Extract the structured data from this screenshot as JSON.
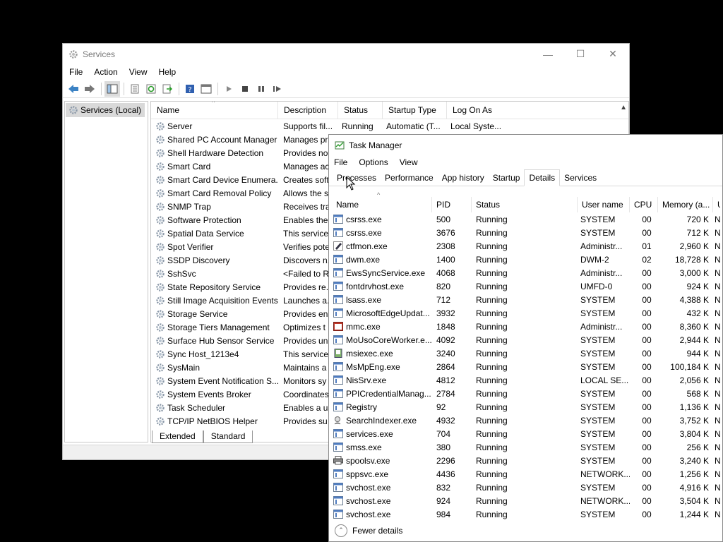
{
  "services": {
    "title": "Services",
    "menu": [
      "File",
      "Action",
      "View",
      "Help"
    ],
    "tree_item": "Services (Local)",
    "columns": [
      "Name",
      "Description",
      "Status",
      "Startup Type",
      "Log On As"
    ],
    "rows": [
      {
        "name": "Server",
        "desc": "Supports fil...",
        "status": "Running",
        "startup": "Automatic (T...",
        "logon": "Local Syste..."
      },
      {
        "name": "Shared PC Account Manager",
        "desc": "Manages pr",
        "status": "",
        "startup": "",
        "logon": ""
      },
      {
        "name": "Shell Hardware Detection",
        "desc": "Provides no",
        "status": "",
        "startup": "",
        "logon": ""
      },
      {
        "name": "Smart Card",
        "desc": "Manages ac",
        "status": "",
        "startup": "",
        "logon": ""
      },
      {
        "name": "Smart Card Device Enumera...",
        "desc": "Creates soft",
        "status": "",
        "startup": "",
        "logon": ""
      },
      {
        "name": "Smart Card Removal Policy",
        "desc": "Allows the s",
        "status": "",
        "startup": "",
        "logon": ""
      },
      {
        "name": "SNMP Trap",
        "desc": "Receives tra",
        "status": "",
        "startup": "",
        "logon": ""
      },
      {
        "name": "Software Protection",
        "desc": "Enables the",
        "status": "",
        "startup": "",
        "logon": ""
      },
      {
        "name": "Spatial Data Service",
        "desc": "This service",
        "status": "",
        "startup": "",
        "logon": ""
      },
      {
        "name": "Spot Verifier",
        "desc": "Verifies pote",
        "status": "",
        "startup": "",
        "logon": ""
      },
      {
        "name": "SSDP Discovery",
        "desc": "Discovers n...",
        "status": "",
        "startup": "",
        "logon": ""
      },
      {
        "name": "SshSvc",
        "desc": "<Failed to R",
        "status": "",
        "startup": "",
        "logon": ""
      },
      {
        "name": "State Repository Service",
        "desc": "Provides re...",
        "status": "",
        "startup": "",
        "logon": ""
      },
      {
        "name": "Still Image Acquisition Events",
        "desc": "Launches a...",
        "status": "",
        "startup": "",
        "logon": ""
      },
      {
        "name": "Storage Service",
        "desc": "Provides en",
        "status": "",
        "startup": "",
        "logon": ""
      },
      {
        "name": "Storage Tiers Management",
        "desc": "Optimizes t",
        "status": "",
        "startup": "",
        "logon": ""
      },
      {
        "name": "Surface Hub Sensor Service",
        "desc": "Provides un",
        "status": "",
        "startup": "",
        "logon": ""
      },
      {
        "name": "Sync Host_1213e4",
        "desc": "This service",
        "status": "",
        "startup": "",
        "logon": ""
      },
      {
        "name": "SysMain",
        "desc": "Maintains a",
        "status": "",
        "startup": "",
        "logon": ""
      },
      {
        "name": "System Event Notification S...",
        "desc": "Monitors sy",
        "status": "",
        "startup": "",
        "logon": ""
      },
      {
        "name": "System Events Broker",
        "desc": "Coordinates",
        "status": "",
        "startup": "",
        "logon": ""
      },
      {
        "name": "Task Scheduler",
        "desc": "Enables a us",
        "status": "",
        "startup": "",
        "logon": ""
      },
      {
        "name": "TCP/IP NetBIOS Helper",
        "desc": "Provides su",
        "status": "",
        "startup": "",
        "logon": ""
      }
    ],
    "tabs": [
      "Extended",
      "Standard"
    ]
  },
  "taskmgr": {
    "title": "Task Manager",
    "menu": [
      "File",
      "Options",
      "View"
    ],
    "tabs": [
      "Processes",
      "Performance",
      "App history",
      "Startup",
      "Details",
      "Services"
    ],
    "selected_tab": "Details",
    "columns": [
      "Name",
      "PID",
      "Status",
      "User name",
      "CPU",
      "Memory (a...",
      "U"
    ],
    "rows": [
      {
        "name": "csrss.exe",
        "pid": "500",
        "status": "Running",
        "user": "SYSTEM",
        "cpu": "00",
        "mem": "720 K",
        "x": "N",
        "icon": "app"
      },
      {
        "name": "csrss.exe",
        "pid": "3676",
        "status": "Running",
        "user": "SYSTEM",
        "cpu": "00",
        "mem": "712 K",
        "x": "N",
        "icon": "app"
      },
      {
        "name": "ctfmon.exe",
        "pid": "2308",
        "status": "Running",
        "user": "Administr...",
        "cpu": "01",
        "mem": "2,960 K",
        "x": "N",
        "icon": "pen"
      },
      {
        "name": "dwm.exe",
        "pid": "1400",
        "status": "Running",
        "user": "DWM-2",
        "cpu": "02",
        "mem": "18,728 K",
        "x": "N",
        "icon": "app"
      },
      {
        "name": "EwsSyncService.exe",
        "pid": "4068",
        "status": "Running",
        "user": "Administr...",
        "cpu": "00",
        "mem": "3,000 K",
        "x": "N",
        "icon": "app"
      },
      {
        "name": "fontdrvhost.exe",
        "pid": "820",
        "status": "Running",
        "user": "UMFD-0",
        "cpu": "00",
        "mem": "924 K",
        "x": "N",
        "icon": "app"
      },
      {
        "name": "lsass.exe",
        "pid": "712",
        "status": "Running",
        "user": "SYSTEM",
        "cpu": "00",
        "mem": "4,388 K",
        "x": "N",
        "icon": "app"
      },
      {
        "name": "MicrosoftEdgeUpdat...",
        "pid": "3932",
        "status": "Running",
        "user": "SYSTEM",
        "cpu": "00",
        "mem": "432 K",
        "x": "N",
        "icon": "app"
      },
      {
        "name": "mmc.exe",
        "pid": "1848",
        "status": "Running",
        "user": "Administr...",
        "cpu": "00",
        "mem": "8,360 K",
        "x": "N",
        "icon": "mmc"
      },
      {
        "name": "MoUsoCoreWorker.e...",
        "pid": "4092",
        "status": "Running",
        "user": "SYSTEM",
        "cpu": "00",
        "mem": "2,944 K",
        "x": "N",
        "icon": "app"
      },
      {
        "name": "msiexec.exe",
        "pid": "3240",
        "status": "Running",
        "user": "SYSTEM",
        "cpu": "00",
        "mem": "944 K",
        "x": "N",
        "icon": "msi"
      },
      {
        "name": "MsMpEng.exe",
        "pid": "2864",
        "status": "Running",
        "user": "SYSTEM",
        "cpu": "00",
        "mem": "100,184 K",
        "x": "N",
        "icon": "app"
      },
      {
        "name": "NisSrv.exe",
        "pid": "4812",
        "status": "Running",
        "user": "LOCAL SE...",
        "cpu": "00",
        "mem": "2,056 K",
        "x": "N",
        "icon": "app"
      },
      {
        "name": "PPICredentialManag...",
        "pid": "2784",
        "status": "Running",
        "user": "SYSTEM",
        "cpu": "00",
        "mem": "568 K",
        "x": "N",
        "icon": "app"
      },
      {
        "name": "Registry",
        "pid": "92",
        "status": "Running",
        "user": "SYSTEM",
        "cpu": "00",
        "mem": "1,136 K",
        "x": "N",
        "icon": "app"
      },
      {
        "name": "SearchIndexer.exe",
        "pid": "4932",
        "status": "Running",
        "user": "SYSTEM",
        "cpu": "00",
        "mem": "3,752 K",
        "x": "N",
        "icon": "search"
      },
      {
        "name": "services.exe",
        "pid": "704",
        "status": "Running",
        "user": "SYSTEM",
        "cpu": "00",
        "mem": "3,804 K",
        "x": "N",
        "icon": "app"
      },
      {
        "name": "smss.exe",
        "pid": "380",
        "status": "Running",
        "user": "SYSTEM",
        "cpu": "00",
        "mem": "256 K",
        "x": "N",
        "icon": "app"
      },
      {
        "name": "spoolsv.exe",
        "pid": "2296",
        "status": "Running",
        "user": "SYSTEM",
        "cpu": "00",
        "mem": "3,240 K",
        "x": "N",
        "icon": "printer"
      },
      {
        "name": "sppsvc.exe",
        "pid": "4436",
        "status": "Running",
        "user": "NETWORK...",
        "cpu": "00",
        "mem": "1,256 K",
        "x": "N",
        "icon": "app"
      },
      {
        "name": "svchost.exe",
        "pid": "832",
        "status": "Running",
        "user": "SYSTEM",
        "cpu": "00",
        "mem": "4,916 K",
        "x": "N",
        "icon": "app"
      },
      {
        "name": "svchost.exe",
        "pid": "924",
        "status": "Running",
        "user": "NETWORK...",
        "cpu": "00",
        "mem": "3,504 K",
        "x": "N",
        "icon": "app"
      },
      {
        "name": "svchost.exe",
        "pid": "984",
        "status": "Running",
        "user": "SYSTEM",
        "cpu": "00",
        "mem": "1,244 K",
        "x": "N",
        "icon": "app"
      }
    ],
    "footer": "Fewer details"
  }
}
